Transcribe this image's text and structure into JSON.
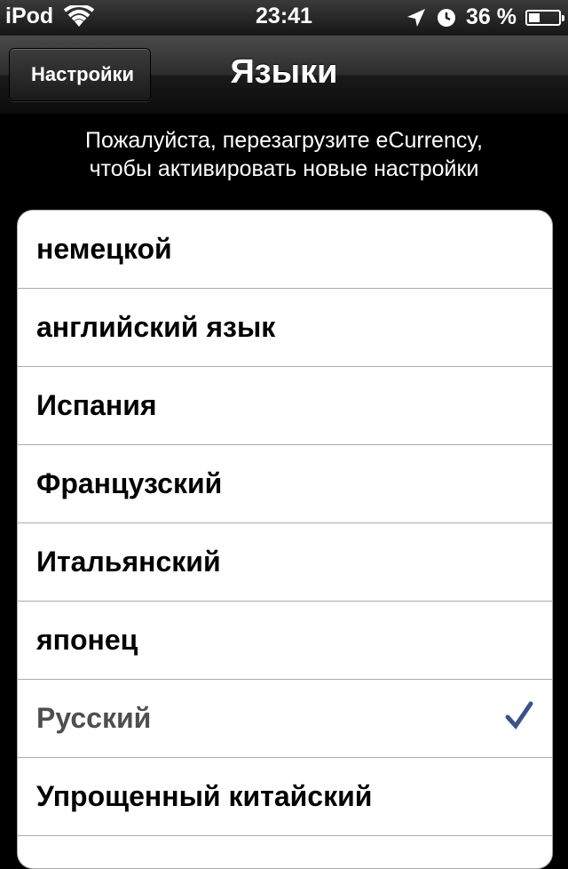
{
  "status_bar": {
    "carrier": "iPod",
    "time": "23:41",
    "battery": "36 %",
    "battery_level": 0.36,
    "icons": [
      "wifi-icon",
      "location-arrow-icon",
      "alarm-clock-icon",
      "battery-icon"
    ]
  },
  "navbar": {
    "back_label": "Настройки",
    "title": "Языки"
  },
  "notice": {
    "line1": "Пожалуйста, перезагрузите eCurrency,",
    "line2": "чтобы активировать новые настройки"
  },
  "languages": [
    {
      "label": "немецкой"
    },
    {
      "label": "английский язык"
    },
    {
      "label": "Испания"
    },
    {
      "label": "Французский"
    },
    {
      "label": "Итальянский"
    },
    {
      "label": "японец"
    },
    {
      "label": "Русский",
      "selected": true
    },
    {
      "label": "Упрощенный китайский"
    }
  ],
  "colors": {
    "checkmark": "#3a5388",
    "selected_text": "#4e4e4e"
  }
}
